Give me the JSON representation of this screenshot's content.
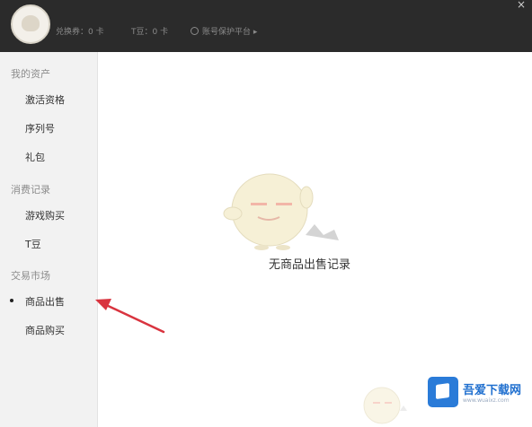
{
  "header": {
    "stat1": "兑换券：0 卡",
    "stat2": "T豆：0 卡",
    "protect_label": "账号保护平台 ▸",
    "close_glyph": "×"
  },
  "sidebar": {
    "groups": [
      {
        "title": "我的资产",
        "items": [
          "激活资格",
          "序列号",
          "礼包"
        ]
      },
      {
        "title": "消费记录",
        "items": [
          "游戏购买",
          "T豆"
        ]
      },
      {
        "title": "交易市场",
        "items": [
          "商品出售",
          "商品购买"
        ]
      }
    ],
    "selected": "商品出售"
  },
  "main": {
    "empty_text": "无商品出售记录"
  },
  "watermark": {
    "name": "吾爱下载网",
    "url": "www.wuaixz.com"
  },
  "colors": {
    "topbar": "#2b2b2b",
    "sidebar": "#f2f2f2",
    "arrow": "#d9343f",
    "brand_blue": "#2a7bd8"
  }
}
